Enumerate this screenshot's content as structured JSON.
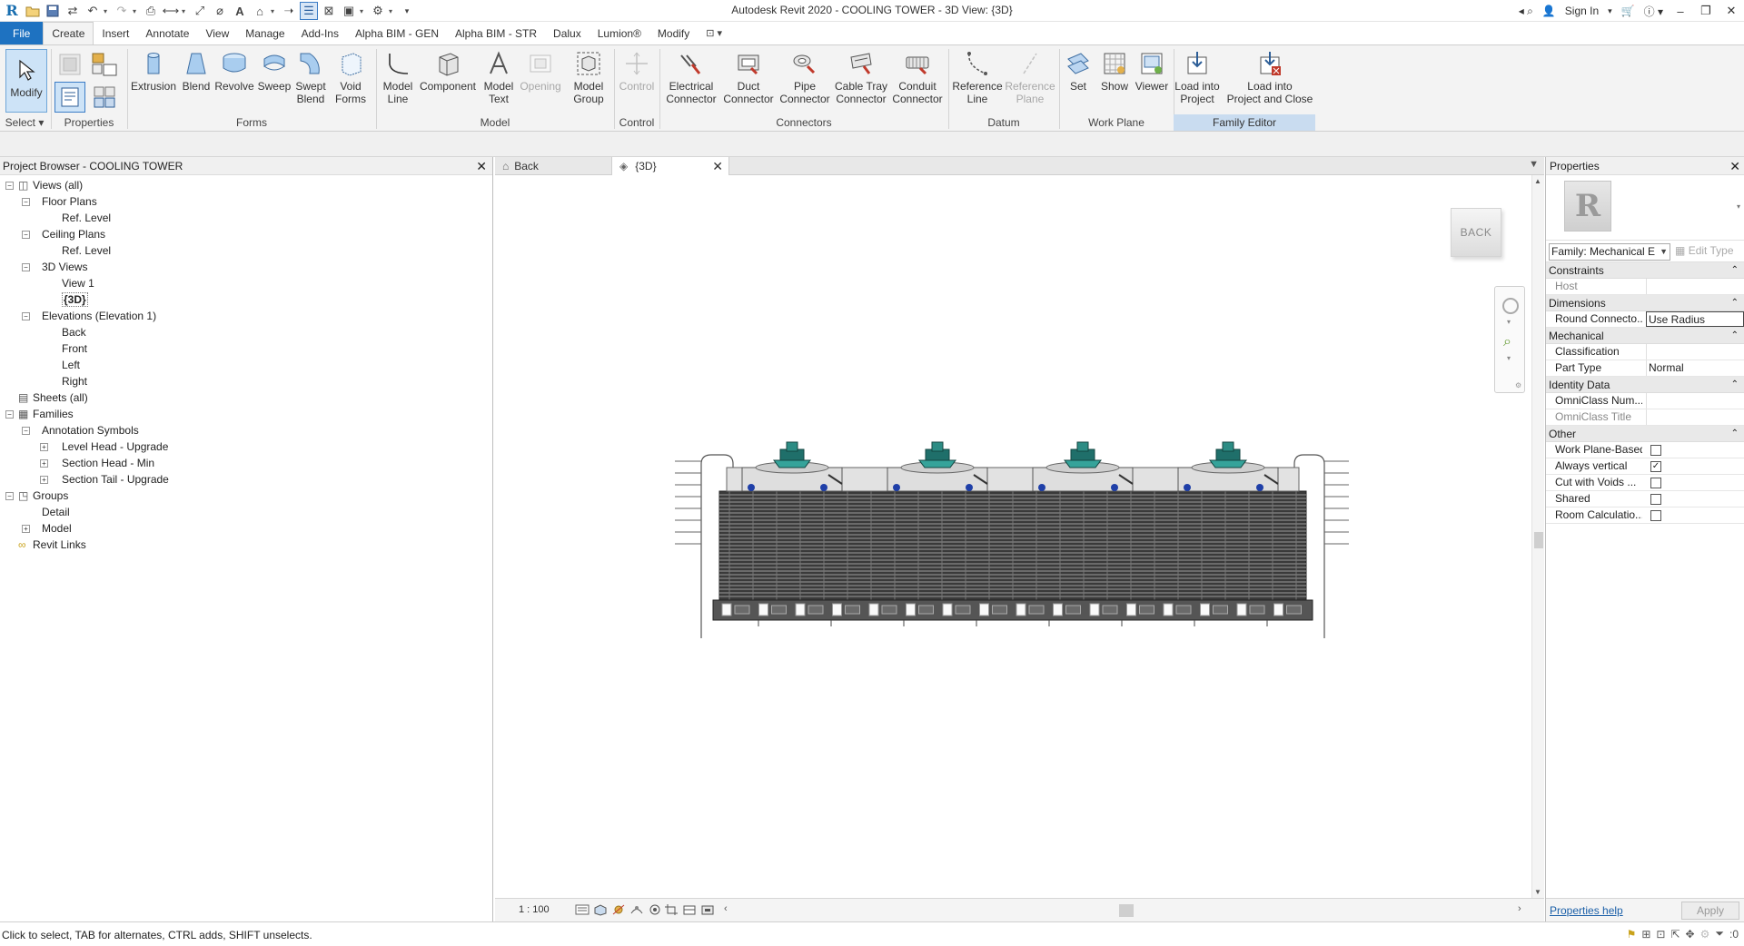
{
  "titlebar": {
    "title": "Autodesk Revit 2020 - COOLING TOWER - 3D View: {3D}",
    "sign_in": "Sign In"
  },
  "menu": {
    "tabs": [
      "File",
      "Create",
      "Insert",
      "Annotate",
      "View",
      "Manage",
      "Add-Ins",
      "Alpha BIM - GEN",
      "Alpha BIM - STR",
      "Dalux",
      "Lumion®",
      "Modify"
    ],
    "active": "Create"
  },
  "ribbon": {
    "select": {
      "modify": "Modify",
      "label": "Select"
    },
    "properties_label": "Properties",
    "forms": {
      "label": "Forms",
      "buttons": [
        "Extrusion",
        "Blend",
        "Revolve",
        "Sweep",
        "Swept\nBlend",
        "Void\nForms"
      ]
    },
    "model": {
      "label": "Model",
      "buttons": [
        "Model\nLine",
        "Component",
        "Model\nText",
        "Opening",
        "Model\nGroup"
      ]
    },
    "control": {
      "label": "Control",
      "buttons": [
        "Control"
      ]
    },
    "connectors": {
      "label": "Connectors",
      "buttons": [
        "Electrical\nConnector",
        "Duct\nConnector",
        "Pipe\nConnector",
        "Cable Tray\nConnector",
        "Conduit\nConnector"
      ]
    },
    "datum": {
      "label": "Datum",
      "buttons": [
        "Reference\nLine",
        "Reference\nPlane"
      ]
    },
    "workplane": {
      "label": "Work Plane",
      "buttons": [
        "Set",
        "Show",
        "Viewer"
      ]
    },
    "family_editor": {
      "label": "Family Editor",
      "buttons": [
        "Load into\nProject",
        "Load into\nProject and Close"
      ]
    }
  },
  "project_browser": {
    "title": "Project Browser - COOLING TOWER",
    "nodes": [
      {
        "label": "Views (all)",
        "level": 0,
        "toggle": "-",
        "icon": "views-icon"
      },
      {
        "label": "Floor Plans",
        "level": 1,
        "toggle": "-"
      },
      {
        "label": "Ref. Level",
        "level": 2,
        "toggle": ""
      },
      {
        "label": "Ceiling Plans",
        "level": 1,
        "toggle": "-"
      },
      {
        "label": "Ref. Level",
        "level": 2,
        "toggle": ""
      },
      {
        "label": "3D Views",
        "level": 1,
        "toggle": "-"
      },
      {
        "label": "View 1",
        "level": 2,
        "toggle": ""
      },
      {
        "label": "{3D}",
        "level": 2,
        "toggle": "",
        "current": true
      },
      {
        "label": "Elevations (Elevation 1)",
        "level": 1,
        "toggle": "-"
      },
      {
        "label": "Back",
        "level": 2,
        "toggle": ""
      },
      {
        "label": "Front",
        "level": 2,
        "toggle": ""
      },
      {
        "label": "Left",
        "level": 2,
        "toggle": ""
      },
      {
        "label": "Right",
        "level": 2,
        "toggle": ""
      },
      {
        "label": "Sheets (all)",
        "level": 0,
        "toggle": "",
        "icon": "sheets-icon"
      },
      {
        "label": "Families",
        "level": 0,
        "toggle": "-",
        "icon": "families-icon"
      },
      {
        "label": "Annotation Symbols",
        "level": 1,
        "toggle": "-"
      },
      {
        "label": "Level Head - Upgrade",
        "level": 2,
        "toggle": "+"
      },
      {
        "label": "Section Head - Min",
        "level": 2,
        "toggle": "+"
      },
      {
        "label": "Section Tail - Upgrade",
        "level": 2,
        "toggle": "+"
      },
      {
        "label": "Groups",
        "level": 0,
        "toggle": "-",
        "icon": "groups-icon"
      },
      {
        "label": "Detail",
        "level": 1,
        "toggle": ""
      },
      {
        "label": "Model",
        "level": 1,
        "toggle": "+"
      },
      {
        "label": "Revit Links",
        "level": 0,
        "toggle": "",
        "icon": "links-icon"
      }
    ]
  },
  "view_tabs": [
    {
      "label": "Back",
      "active": false
    },
    {
      "label": "{3D}",
      "active": true
    }
  ],
  "viewcube": {
    "face": "BACK"
  },
  "view_control": {
    "scale": "1 : 100"
  },
  "properties": {
    "title": "Properties",
    "family_selector": "Family: Mechanical E",
    "edit_type": "Edit Type",
    "groups": [
      {
        "name": "Constraints",
        "rows": [
          {
            "name": "Host",
            "value": "",
            "gray": true
          }
        ]
      },
      {
        "name": "Dimensions",
        "rows": [
          {
            "name": "Round Connecto...",
            "value": "Use Radius",
            "boxed": true
          }
        ]
      },
      {
        "name": "Mechanical",
        "rows": [
          {
            "name": "Classification",
            "value": ""
          },
          {
            "name": "Part Type",
            "value": "Normal"
          }
        ]
      },
      {
        "name": "Identity Data",
        "rows": [
          {
            "name": "OmniClass Num...",
            "value": ""
          },
          {
            "name": "OmniClass Title",
            "value": "",
            "gray": true
          }
        ]
      },
      {
        "name": "Other",
        "rows": [
          {
            "name": "Work Plane-Based",
            "check": false
          },
          {
            "name": "Always vertical",
            "check": true
          },
          {
            "name": "Cut with Voids ...",
            "check": false
          },
          {
            "name": "Shared",
            "check": false
          },
          {
            "name": "Room Calculatio...",
            "check": false
          }
        ]
      }
    ],
    "help_link": "Properties help",
    "apply": "Apply"
  },
  "statusbar": {
    "message": "Click to select, TAB for alternates, CTRL adds, SHIFT unselects.",
    "filter_count": ":0"
  }
}
